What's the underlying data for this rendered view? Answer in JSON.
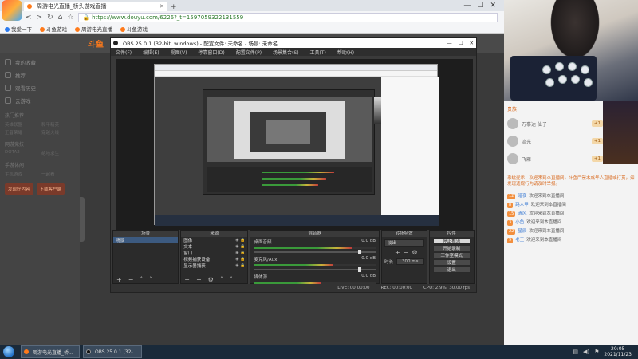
{
  "browser": {
    "tab_title": "周游电光直播_桥头游戏直播",
    "url": "https://www.douyu.com/6226?_t=1597059322131559",
    "bookmarks": [
      "我爱一下",
      "斗鱼游戏",
      "周游电光直播",
      "斗鱼游戏"
    ]
  },
  "site": {
    "logo": "斗鱼",
    "nav_items": [
      "我的收藏",
      "推荐",
      "观看历史",
      "云游戏"
    ],
    "nav_sections": [
      "热门推荐",
      "网游竞技",
      "手游休闲"
    ],
    "nav_grid": [
      "英雄联盟",
      "和平精英",
      "王者荣耀",
      "穿越火线",
      "DOTA2",
      "绝地求生",
      "主机游戏",
      "一起看"
    ],
    "buttons": [
      "发现好内容",
      "下载客户端"
    ]
  },
  "rank": {
    "title": "贵族",
    "rows": [
      {
        "name": "万事达·仙子",
        "badge": "+1"
      },
      {
        "name": "流光",
        "badge": "+1"
      },
      {
        "name": "飞雁",
        "badge": "+1"
      }
    ]
  },
  "chat": {
    "notice": "系统提示：欢迎来到本直播间，斗鱼严禁未成年人直播或打赏，如发现违规行为请及时举报。",
    "rows": [
      {
        "level": "12",
        "user": "暗夜",
        "text": "欢迎来到本直播间"
      },
      {
        "level": "8",
        "user": "路人甲",
        "text": "欢迎来到本直播间"
      },
      {
        "level": "15",
        "user": "清风",
        "text": "欢迎来到本直播间"
      },
      {
        "level": "3",
        "user": "小鱼",
        "text": "欢迎来到本直播间"
      },
      {
        "level": "22",
        "user": "星辰",
        "text": "欢迎来到本直播间"
      },
      {
        "level": "9",
        "user": "老王",
        "text": "欢迎来到本直播间"
      }
    ]
  },
  "obs": {
    "title": "OBS 25.0.1 (32-bit, windows) - 配置文件: 未命名 - 场景: 未命名",
    "menu": [
      "文件(F)",
      "编辑(E)",
      "视图(V)",
      "停靠窗口(D)",
      "配置文件(P)",
      "场景集合(S)",
      "工具(T)",
      "帮助(H)"
    ],
    "docks": {
      "scenes": {
        "title": "场景",
        "items": [
          "场景"
        ]
      },
      "sources": {
        "title": "来源",
        "items": [
          "图像",
          "文本",
          "窗口",
          "视频捕获设备",
          "显示器捕获"
        ]
      },
      "mixer": {
        "title": "混音器",
        "rows": [
          {
            "name": "桌面音频",
            "db": "0.0 dB",
            "level": 0.8
          },
          {
            "name": "麦克风/Aux",
            "db": "0.0 dB",
            "level": 0.65
          },
          {
            "name": "媒体源",
            "db": "0.0 dB",
            "level": 0.55
          }
        ]
      },
      "transitions": {
        "title": "转场特效",
        "selected": "淡出",
        "duration_label": "时长",
        "duration": "300 ms"
      },
      "controls": {
        "title": "控件",
        "buttons": [
          "停止推流",
          "开始录制",
          "工作室模式",
          "设置",
          "退出"
        ]
      }
    },
    "status": [
      "LIVE: 00:00:00",
      "REC: 00:00:00",
      "CPU: 2.9%, 30.00 fps"
    ]
  },
  "taskbar": {
    "tasks": [
      "周游电光直播_桥...",
      "OBS 25.0.1 (32-..."
    ],
    "time": "20:05",
    "date": "2021/11/23"
  }
}
